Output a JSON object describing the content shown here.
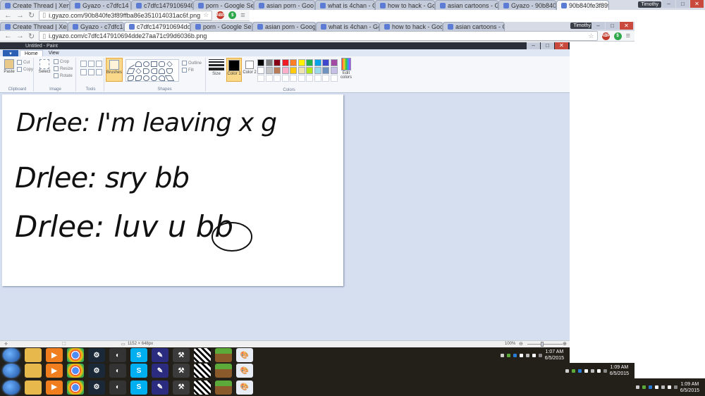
{
  "outer_browser": {
    "tabs": [
      {
        "label": "Create Thread | Xen"
      },
      {
        "label": "Gyazo - c7dfc14"
      },
      {
        "label": "c7dfc1479106940"
      },
      {
        "label": "porn - Google Se"
      },
      {
        "label": "asian porn - Goo"
      },
      {
        "label": "what is 4chan - G"
      },
      {
        "label": "how to hack - Go"
      },
      {
        "label": "asian cartoons - G"
      },
      {
        "label": "Gyazo - 90b840"
      },
      {
        "label": "90b840fe3f89ffb"
      }
    ],
    "user": "Timothy",
    "url": "i.gyazo.com/90b840fe3f89ffba86e351014031ac6f.png"
  },
  "inner_browser": {
    "tabs": [
      {
        "label": "Create Thread | Xen"
      },
      {
        "label": "Gyazo - c7dfc147910"
      },
      {
        "label": "c7dfc147910694dde"
      },
      {
        "label": "porn - Google Sear"
      },
      {
        "label": "asian porn - Google"
      },
      {
        "label": "what is 4chan - Goo"
      },
      {
        "label": "how to hack - Goog"
      },
      {
        "label": "asian cartoons - Goo"
      }
    ],
    "user": "Timothy",
    "url": "i.gyazo.com/c7dfc147910694dde27aa71c99d6036b.png"
  },
  "paint": {
    "title": "Untitled - Paint",
    "tabs": {
      "file": "▾",
      "home": "Home",
      "view": "View"
    },
    "groups": {
      "clipboard": {
        "label": "Clipboard",
        "paste": "Paste",
        "cut": "Cut",
        "copy": "Copy"
      },
      "image": {
        "label": "Image",
        "select": "Select",
        "crop": "Crop",
        "resize": "Resize",
        "rotate": "Rotate"
      },
      "tools": {
        "label": "Tools"
      },
      "brushes": {
        "label": "Brushes"
      },
      "shapes": {
        "label": "Shapes",
        "outline": "Outline",
        "fill": "Fill"
      },
      "size": {
        "label": "Size"
      },
      "colors": {
        "label": "Colors",
        "color1": "Color 1",
        "color2": "Color 2",
        "edit": "Edit colors"
      }
    },
    "palette": [
      "#000000",
      "#7f7f7f",
      "#880015",
      "#ed1c24",
      "#ff7f27",
      "#fff200",
      "#22b14c",
      "#00a2e8",
      "#3f48cc",
      "#a349a4",
      "#ffffff",
      "#c3c3c3",
      "#b97a57",
      "#ffaec9",
      "#ffc90e",
      "#efe4b0",
      "#b5e61d",
      "#99d9ea",
      "#7092be",
      "#c8bfe7"
    ],
    "canvas_lines": [
      "Drlee: I'm leaving x g",
      "Drlee: sry bb",
      "Drlee: luv u bb"
    ],
    "status": {
      "dimensions": "1152 × 648px",
      "zoom": "100%"
    }
  },
  "taskbars": [
    {
      "time": "1:07 AM",
      "date": "6/5/2015"
    },
    {
      "time": "1:09 AM",
      "date": "6/5/2015"
    },
    {
      "time": "1:09 AM",
      "date": "6/5/2015"
    }
  ],
  "taskbar_icons": [
    "ie-icon",
    "explorer-icon",
    "media-player-icon",
    "chrome-icon",
    "steam-icon",
    "app-icon",
    "skype-icon",
    "pen-icon",
    "tool-icon",
    "qr-icon",
    "minecraft-icon",
    "paint-icon"
  ]
}
